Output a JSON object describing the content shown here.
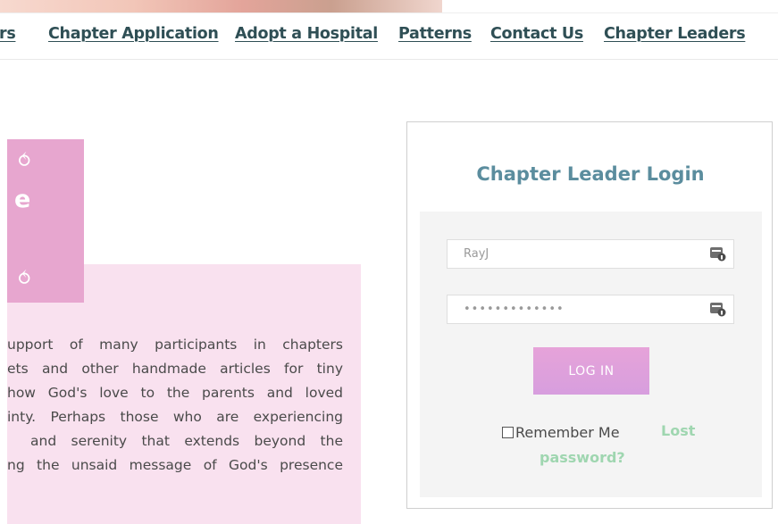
{
  "nav": {
    "items": [
      {
        "label": "rs"
      },
      {
        "label": "Chapter Application"
      },
      {
        "label": "Adopt a Hospital"
      },
      {
        "label": "Patterns"
      },
      {
        "label": "Contact Us"
      },
      {
        "label": "Chapter Leaders"
      }
    ]
  },
  "hero": {
    "heading_fragment": "e",
    "swirl_top": "⥀",
    "swirl_bottom": "⥀"
  },
  "intro": {
    "lines": [
      "upport of many participants in chapters",
      "ets and other handmade articles for tiny",
      "how God's love to the parents and loved",
      "inty. Perhaps those who are experiencing",
      "and serenity that extends beyond the",
      "ng the unsaid message of God's presence"
    ]
  },
  "login": {
    "title": "Chapter Leader Login",
    "username_value": "RayJ",
    "password_value": "•••••••••••••",
    "button_label": "LOG IN",
    "remember_label": "Remember Me",
    "lost_password_line1": "Lost",
    "lost_password_line2": "password?",
    "field_icon": "password-manager-key-icon"
  },
  "colors": {
    "nav_text": "#2f4f55",
    "title": "#5b8d9e",
    "accent_pink": "#e7a6cf",
    "pale_pink": "#f9e1ef",
    "button": "#e0a1dc",
    "link_green": "#9fd6b0"
  }
}
